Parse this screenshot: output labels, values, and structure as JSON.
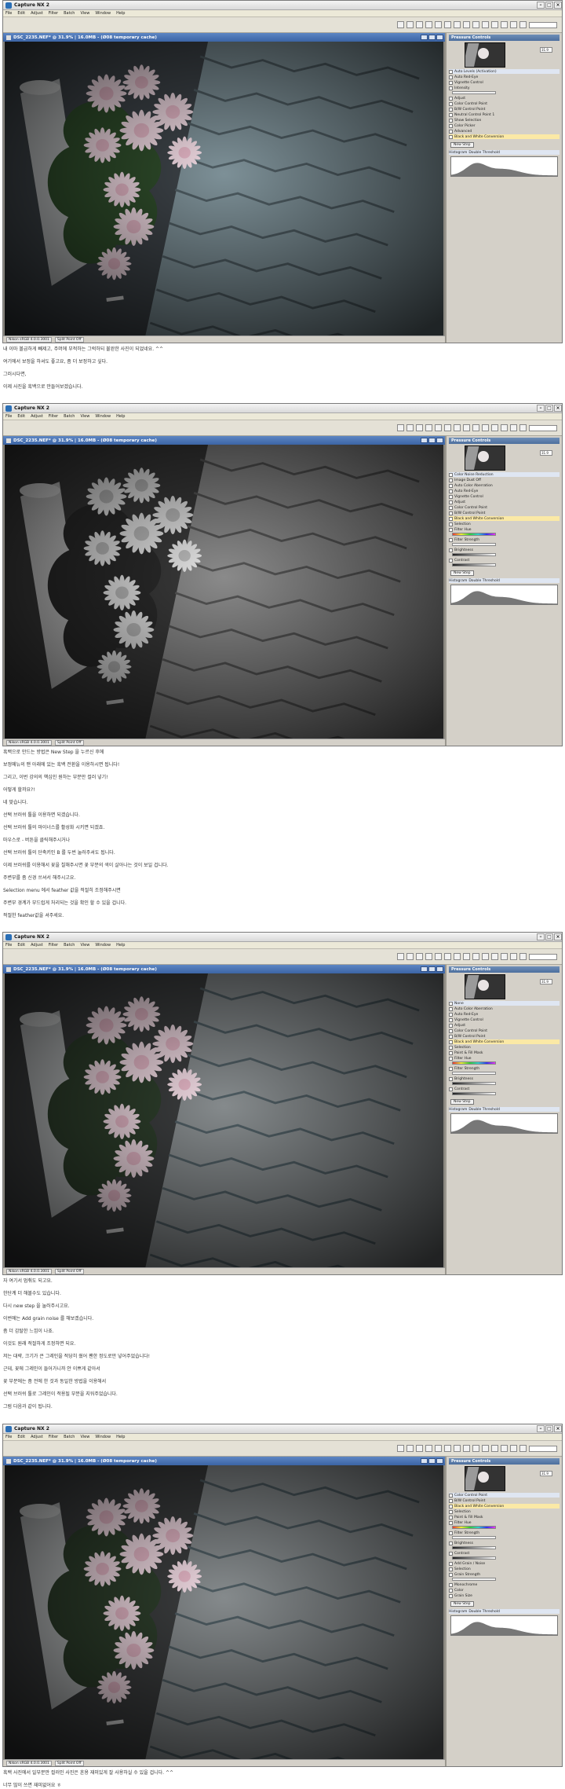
{
  "app": {
    "title": "Capture NX 2",
    "menu": [
      "File",
      "Edit",
      "Adjust",
      "Filter",
      "Batch",
      "View",
      "Window",
      "Help"
    ],
    "doc_title": "DSC_2235.NEF* @ 31.9% | 16.0MB - (Ø08 temporary cache)",
    "panel_title": "Pressure Controls",
    "zoom": "31.9",
    "status": [
      "Nikon sRGB 4.0.0.3001",
      "Split Point Off"
    ]
  },
  "shots": [
    {
      "id": "shot-1",
      "panel_rows": [
        "Auto Levels (Activation)",
        "Auto Red-Eye",
        "Vignette Control",
        "Intensity",
        "Adjust",
        "Color Control Point",
        "B/W Control Point",
        "Neutral Control Point 1",
        "Show Selection",
        "Color Picker",
        "Advanced",
        "Black and White Conversion"
      ],
      "new_step": "New Step",
      "histogram_label": "Histogram",
      "histogram_mode": "Double Threshold",
      "photo_mode": "color"
    },
    {
      "id": "shot-2",
      "panel_rows": [
        "Color Noise Reduction",
        "Image Dust Off",
        "Auto Color Aberration",
        "Auto Red-Eye",
        "Vignette Control",
        "Adjust",
        "Color Control Point",
        "B/W Control Point",
        "Black and White Conversion",
        "Selection",
        "Filter Hue",
        "Filter Strength",
        "Brightness",
        "Contrast"
      ],
      "new_step": "New Step",
      "histogram_label": "Histogram",
      "histogram_mode": "Double Threshold",
      "photo_mode": "bw"
    },
    {
      "id": "shot-3",
      "panel_rows": [
        "None",
        "Auto Color Aberration",
        "Auto Red-Eye",
        "Vignette Control",
        "Adjust",
        "Color Control Point",
        "B/W Control Point",
        "Black and White Conversion",
        "Selection",
        "Paint & Fill Mask",
        "Filter Hue",
        "Filter Strength",
        "Brightness",
        "Contrast"
      ],
      "new_step": "New Step",
      "histogram_label": "Histogram",
      "histogram_mode": "Double Threshold",
      "photo_mode": "select"
    },
    {
      "id": "shot-4",
      "panel_rows": [
        "Color Control Point",
        "B/W Control Point",
        "Black and White Conversion",
        "Selection",
        "Paint & Fill Mask",
        "Filter Hue",
        "Filter Strength",
        "Brightness",
        "Contrast",
        "Add Grain / Noise",
        "Selection",
        "Grain Strength",
        "Monochrome",
        "Color",
        "Grain Size"
      ],
      "new_step": "New Step",
      "histogram_label": "Histogram",
      "histogram_mode": "Double Threshold",
      "photo_mode": "select"
    }
  ],
  "texts": [
    [
      "내 이마 볼급하게 빼제고, 주머에 부적하는 그럭하되 불완한 사진이 되었네요. ^^",
      "여기에서 보정을 하셔도 좋고요, 좀 더 보정하고 싶다.",
      "그러시다면,",
      "이제 사진을 흑백으로 만들어보겠습니다."
    ],
    [
      "흑백으로 만드는 방법은 New Step 을 누르신 후에",
      "보정메뉴의 맨 아래에 있는 흑백 전환을 이용하시면 됩니다!",
      "그리고, 이번 강의의 핵심인 원하는 부분만 컬러 넣기!",
      "어떻게 할까요?!",
      "네 맞습니다.",
      "선택 브러쉬 툴을 이용하면 되겠습니다.",
      "선택 브러쉬 툴의 마이너스를 활성화 시키면 되겠죠.",
      "마우스로 - 버튼을 클릭해주시거나",
      "선택 브러쉬 툴의 단축키인 B 를 두번 눌러주셔도 됩니다.",
      "이제 브러쉬를 이용해서 꽃을 칠해주시면 꽃 부분의 색이 살아나는 것이 보일 겁니다.",
      "주변부를 좀 신경 쓰셔서 해주시고요.",
      "Selection menu 에서 feather 값을 적절히 조정해주시면",
      "주변부 경계가 부드럽게 처리되는 것을 확인 할 수 있을 겁니다.",
      "적절한 feather값을 셔주세요."
    ],
    [
      "자 여기서 멈춰도 되고요.",
      "한단계 더 해볼수도 있습니다.",
      "다시 new step 을 눌러주시고요.",
      "이번에는 Add grain noise 를 해보겠습니다.",
      "좀 더 감탈한 느낌이 나죠.",
      "이것도 원래 적절하게 조정하면 되요.",
      "저는 대략, 크기가 큰 그레인을 적당히 줬어 팬한 정도로만 넣어주었습니다!",
      "근데, 꽃에 그레인이 들어가니까 안 이쁘게 같아서",
      "꽃 부분에는 좀 전에 한 것과 동일한 방법을 이용해서",
      "선택 브러쉬 툴로 그레인이 적용될 부분을 지워주었습니다.",
      "그럼 다음과 같이 됩니다."
    ],
    [
      "흑백 사진에서 일부분만 컬러인 사진은 흔용 재미있게 잘 사용하실 수 있을 겁니다. ^^",
      "너무 많이 쓰면 재미없어요 ㅎ"
    ]
  ]
}
